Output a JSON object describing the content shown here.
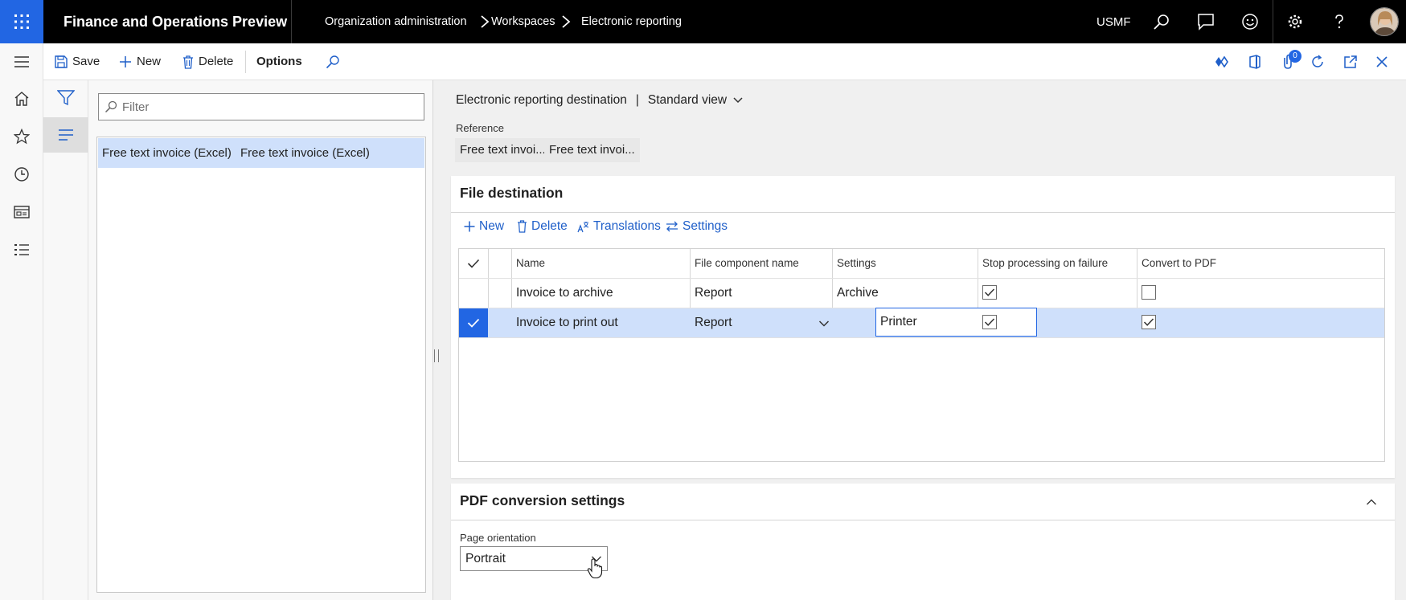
{
  "app": {
    "title": "Finance and Operations Preview",
    "company": "USMF"
  },
  "breadcrumb": {
    "items": [
      "Organization administration",
      "Workspaces",
      "Electronic reporting"
    ]
  },
  "actions": {
    "save": "Save",
    "new": "New",
    "delete": "Delete",
    "options": "Options",
    "notification_count": "0"
  },
  "filter": {
    "placeholder": "Filter"
  },
  "list": {
    "rows": [
      {
        "col1": "Free text invoice (Excel)",
        "col2": "Free text invoice (Excel)"
      }
    ]
  },
  "details": {
    "header": {
      "title": "Electronic reporting destination",
      "separator": "|",
      "view": "Standard view"
    },
    "reference": {
      "label": "Reference",
      "values": [
        "Free text invoi...",
        "Free text invoi..."
      ]
    },
    "file_destination": {
      "title": "File destination",
      "toolbar": {
        "new": "New",
        "delete": "Delete",
        "translations": "Translations",
        "settings": "Settings"
      },
      "columns": {
        "name": "Name",
        "file_component": "File component name",
        "settings": "Settings",
        "stop_processing": "Stop processing on failure",
        "convert_pdf": "Convert to PDF"
      },
      "rows": [
        {
          "name": "Invoice to archive",
          "file_component": "Report",
          "settings": "Archive",
          "stop_processing": true,
          "convert_pdf": false,
          "selected": false
        },
        {
          "name": "Invoice to print out",
          "file_component": "Report",
          "settings": "Printer",
          "stop_processing": true,
          "convert_pdf": true,
          "selected": true
        }
      ]
    },
    "pdf_conversion": {
      "title": "PDF conversion settings",
      "page_orientation": {
        "label": "Page orientation",
        "value": "Portrait"
      }
    }
  },
  "colors": {
    "accent": "#2266e3",
    "selected_row": "#cfe0fb",
    "topbar": "#000000"
  },
  "icons": [
    "waffle-icon",
    "search-icon",
    "chat-icon",
    "smiley-icon",
    "gear-icon",
    "help-icon",
    "hamburger-icon",
    "home-icon",
    "star-icon",
    "clock-icon",
    "workspace-icon",
    "list-icon",
    "filter-icon",
    "save-icon",
    "plus-icon",
    "trash-icon",
    "translations-icon",
    "settings-arrows-icon",
    "chevron-down-icon",
    "chevron-up-icon",
    "refresh-icon",
    "popout-icon",
    "close-icon",
    "office-icon",
    "diamond-icon",
    "attachment-icon"
  ]
}
